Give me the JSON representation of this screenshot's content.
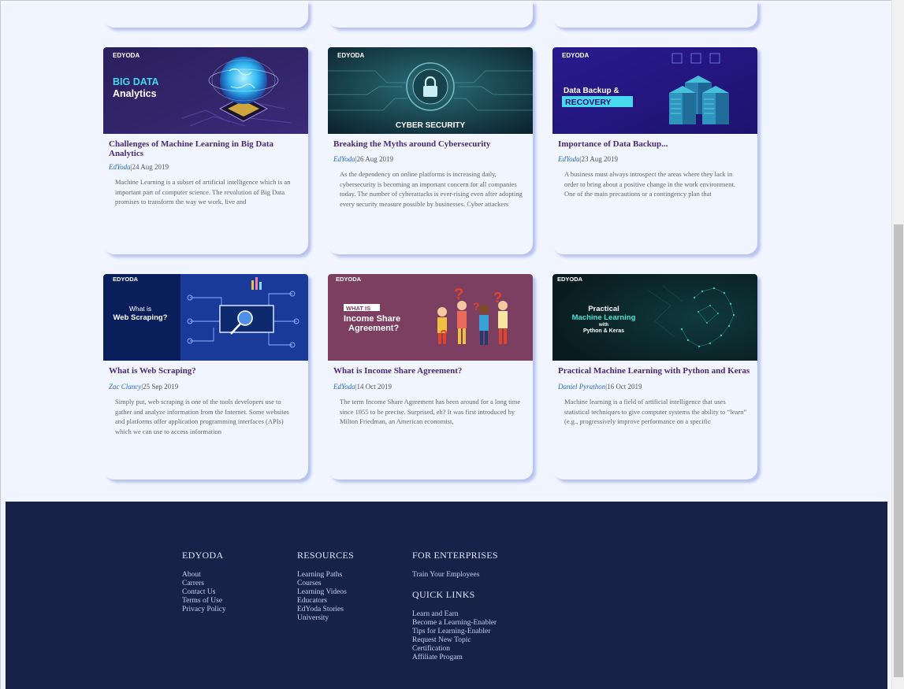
{
  "articles": [
    {
      "title": "Challenges of Machine Learning in Big Data Analytics",
      "author": "EdYoda",
      "sep": "|",
      "date": "24 Aug 2019",
      "description": "Machine Learning is a subset of artificial intelligence which is an important part of computer science. The revolution of Big Data promises to transform the way we work, live and",
      "image": {
        "brand": "EDYODA",
        "line1": "BIG DATA",
        "line2": "Analytics"
      }
    },
    {
      "title": "Breaking the Myths around Cybersecurity",
      "author": "EdYoda",
      "sep": "|",
      "date": "26 Aug 2019",
      "description": "As the dependency on online platforms is increasing daily, cybersecurity is becoming an important concern for all companies today. The number of cyberattacks is ever-rising even after adopting every security measure possible by businesses. Cyber attackers",
      "image": {
        "brand": "EDYODA",
        "line1": "CYBER SECURITY"
      }
    },
    {
      "title": "Importance of Data Backup...",
      "author": "EdYoda",
      "sep": "|",
      "date": "23 Aug 2019",
      "description": "A business must always introspect the areas where they lack in order to bring about a positive change in the work environment. One of the main precautions or a contingency plan that",
      "image": {
        "brand": "EDYODA",
        "line1": "Data Backup &",
        "line2": "RECOVERY"
      }
    },
    {
      "title": "What is Web Scraping?",
      "author": "Zac Clancy",
      "sep": "|",
      "date": "25 Sep 2019",
      "description": "Simply put, web scraping is one of the tools developers use to gather and analyze information from the Internet. Some websites and platforms offer application programming interfaces (APIs) which we can use to access information",
      "image": {
        "brand": "EDYODA",
        "line1": "What is",
        "line2": "Web Scraping?"
      }
    },
    {
      "title": "What is Income Share Agreement?",
      "author": "EdYoda",
      "sep": "|",
      "date": "14 Oct 2019",
      "description": "The term Income Share Agreement has been around for a long time since 1955 to be precise. Surprised, eh? It was first introduced by Milton Friedman, an American economist,",
      "image": {
        "brand": "EDYODA",
        "line1": "WHAT IS",
        "line2": "Income Share",
        "line3": "Agreement?"
      }
    },
    {
      "title": "Practical Machine Learning with Python and Keras",
      "author": "Daniel Pyrathon",
      "sep": "|",
      "date": "16 Oct 2019",
      "description": "Machine learning is a field of artificial intelligence that uses statistical techniques to give computer systems the ability to “learn” (e.g., progressively improve performance on a specific",
      "image": {
        "brand": "EDYODA",
        "line1": "Practical",
        "line2": "Machine Learning",
        "line3": "with",
        "line4": "Python & Keras"
      }
    }
  ],
  "footer": {
    "edyoda": {
      "heading": "EDYODA",
      "links": [
        "About",
        "Carrers",
        "Contact Us",
        "Terms of Use",
        "Privacy Policy"
      ]
    },
    "resources": {
      "heading": "RESOURCES",
      "links": [
        "Learning Paths",
        "Courses",
        "Learning Videos",
        "Educators",
        "EdYoda Stories",
        "University"
      ]
    },
    "enterprises": {
      "heading": "FOR ENTERPRISES",
      "links": [
        "Train Your Employees"
      ]
    },
    "quick_links": {
      "heading": "QUICK LINKS",
      "links": [
        "Learn and Earn",
        "Become a Learning-Enabler",
        "Tips for Learning-Enabler",
        "Request New Topic",
        "Certification",
        "Affiliate Progam"
      ]
    }
  },
  "colors": {
    "page_bg": "#f0f5ff",
    "card_title": "#4a2a78",
    "author_link": "#2a6acb",
    "footer_bg": "#182147"
  }
}
